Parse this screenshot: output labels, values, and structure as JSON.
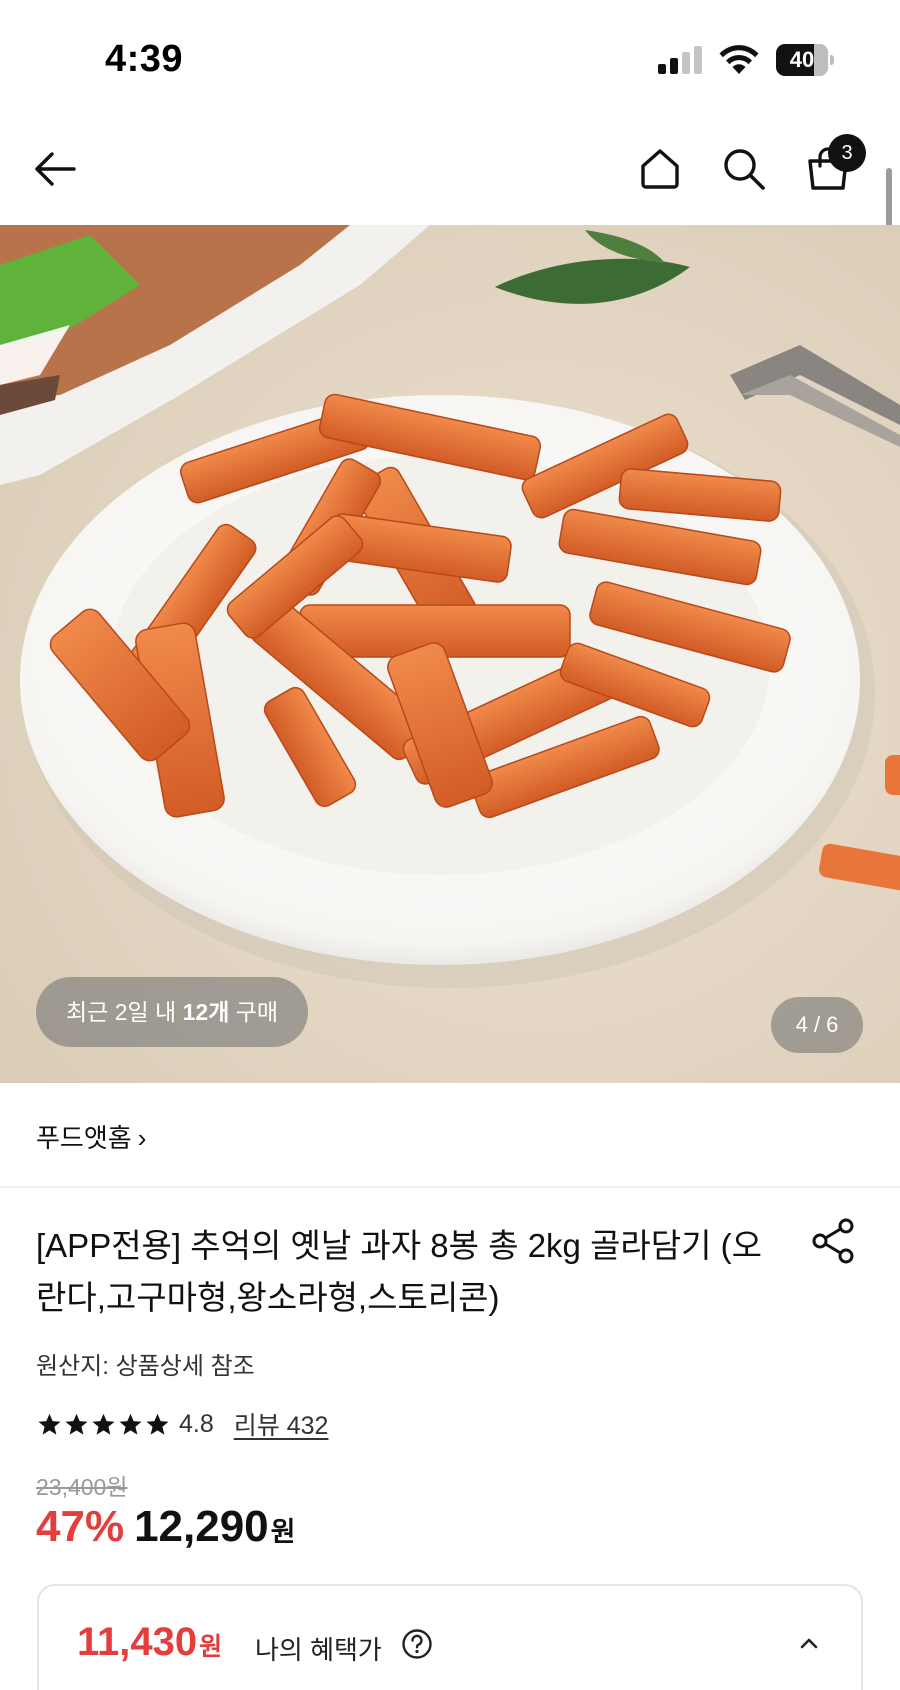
{
  "status_bar": {
    "time": "4:39",
    "battery": "40"
  },
  "nav": {
    "cart_count": "3"
  },
  "hero": {
    "purchase_prefix": "최근 2일 내 ",
    "purchase_count": "12개",
    "purchase_suffix": " 구매",
    "page_indicator": "4 / 6"
  },
  "product": {
    "seller": "푸드앳홈",
    "title": "[APP전용] 추억의 옛날 과자 8봉 총 2kg 골라담기 (오란다,고구마형,왕소라형,스토리콘)",
    "origin": "원산지: 상품상세 참조",
    "rating": "4.8",
    "review_label": "리뷰 432",
    "original_price": "23,400원",
    "discount": "47%",
    "price": "12,290",
    "currency": "원"
  },
  "benefit": {
    "price": "11,430",
    "currency": "원",
    "label": "나의 혜택가"
  },
  "colors": {
    "accent_red": "#e43d3d",
    "text": "#111111",
    "muted": "#999999"
  }
}
